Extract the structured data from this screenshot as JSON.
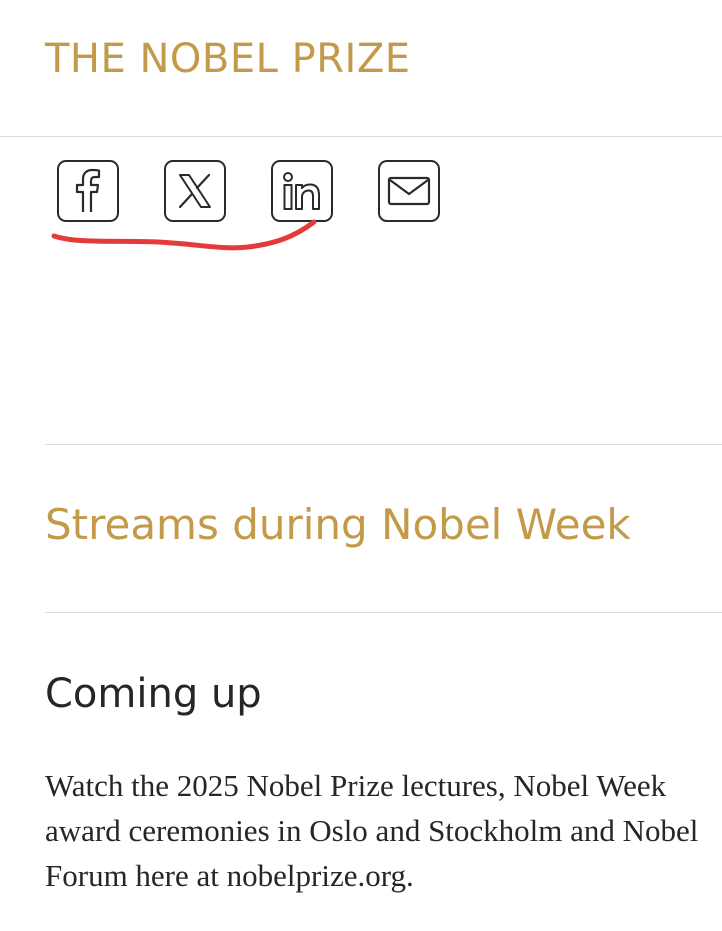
{
  "header": {
    "brand": "THE NOBEL PRIZE"
  },
  "share": {
    "buttons": [
      {
        "name": "facebook",
        "icon": "facebook-icon"
      },
      {
        "name": "x",
        "icon": "x-icon"
      },
      {
        "name": "linkedin",
        "icon": "linkedin-icon"
      },
      {
        "name": "email",
        "icon": "mail-icon"
      }
    ],
    "annotation_color": "#e53a3a"
  },
  "streams": {
    "title": "Streams during Nobel Week"
  },
  "coming_up": {
    "title": "Coming up",
    "body_lines": [
      "Watch the 2025 Nobel Prize lectures, Nobel Week",
      "award ceremonies in Oslo and Stockholm and Nobel",
      "Forum here at nobelprize.org."
    ]
  },
  "colors": {
    "accent": "#c39a4a",
    "text": "#262626",
    "divider": "#dcdcdc"
  }
}
